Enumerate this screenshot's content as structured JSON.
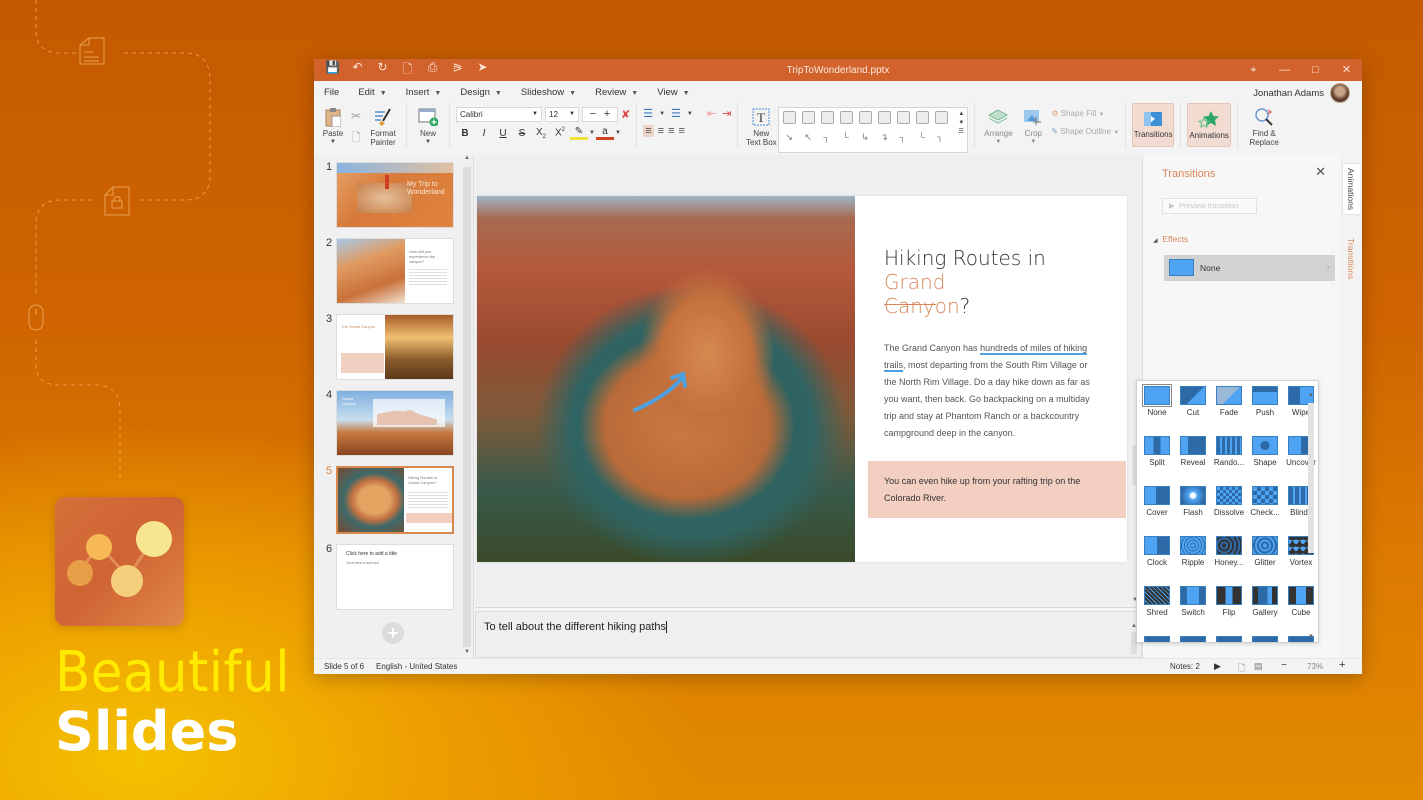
{
  "promo": {
    "line1": "Beautiful",
    "line2": "Slides"
  },
  "window": {
    "title": "TripToWonderland.pptx",
    "quick_access": [
      "save-icon",
      "undo-icon",
      "redo-icon",
      "new-doc-icon",
      "print-icon",
      "share-icon",
      "pointer-icon"
    ]
  },
  "menu": {
    "items": [
      {
        "label": "File",
        "dropdown": false
      },
      {
        "label": "Edit",
        "dropdown": true
      },
      {
        "label": "Insert",
        "dropdown": true
      },
      {
        "label": "Design",
        "dropdown": true
      },
      {
        "label": "Slideshow",
        "dropdown": true
      },
      {
        "label": "Review",
        "dropdown": true
      },
      {
        "label": "View",
        "dropdown": true
      }
    ],
    "user_name": "Jonathan Adams"
  },
  "ribbon": {
    "paste": "Paste",
    "format_painter_1": "Format",
    "format_painter_2": "Painter",
    "new": "New",
    "font_name": "Calibri",
    "font_size": "12",
    "new_text_box_1": "New",
    "new_text_box_2": "Text Box",
    "arrange": "Arrange",
    "crop": "Crop",
    "shape_fill": "Shape Fill",
    "shape_outline": "Shape Outline",
    "transitions": "Transitions",
    "animations": "Animations",
    "find_replace_1": "Find &",
    "find_replace_2": "Replace"
  },
  "thumbnails": [
    {
      "num": "1",
      "title": "My Trip to Wonderland"
    },
    {
      "num": "2",
      "title": "How will you experience the canyon?"
    },
    {
      "num": "3",
      "title": "The Grand Canyon"
    },
    {
      "num": "4",
      "title": "Grand Canyon"
    },
    {
      "num": "5",
      "title": "Hiking Routes in Grand Canyon?",
      "selected": true
    },
    {
      "num": "6",
      "title": "Click here to add a title",
      "subtitle": "Click here to add text"
    }
  ],
  "slide": {
    "title_part1": "Hiking Routes in ",
    "title_accent1": "Grand",
    "title_accent2": "Canyon",
    "title_part2": "?",
    "body_pre": "The Grand Canyon has ",
    "body_hl1": "hundreds of miles of hiking",
    "body_hl2": "trails",
    "body_post": ", most departing from the South Rim Village or the North Rim Village. Do a day hike down as far as you want, then back. Go backpacking on a multiday trip and stay at Phantom Ranch or a backcountry campground deep in the canyon.",
    "callout": "You can even hike up from your rafting trip on the Colorado River.",
    "accent_color": "#d9865a",
    "callout_bg": "#f2cfc0"
  },
  "notes": {
    "text": "To tell about the different hiking paths"
  },
  "panel": {
    "title": "Transitions",
    "preview_button": "Preview transition",
    "effects_label": "Effects",
    "selected_effect": "None",
    "side_tabs": [
      "Animations",
      "Transitions"
    ],
    "gallery": [
      {
        "label": "None",
        "selected": true
      },
      {
        "label": "Cut"
      },
      {
        "label": "Fade"
      },
      {
        "label": "Push"
      },
      {
        "label": "Wipe"
      },
      {
        "label": "Split"
      },
      {
        "label": "Reveal"
      },
      {
        "label": "Rando..."
      },
      {
        "label": "Shape"
      },
      {
        "label": "Uncover"
      },
      {
        "label": "Cover"
      },
      {
        "label": "Flash"
      },
      {
        "label": "Dissolve"
      },
      {
        "label": "Check..."
      },
      {
        "label": "Blinds"
      },
      {
        "label": "Clock"
      },
      {
        "label": "Ripple"
      },
      {
        "label": "Honey..."
      },
      {
        "label": "Glitter"
      },
      {
        "label": "Vortex"
      },
      {
        "label": "Shred"
      },
      {
        "label": "Switch"
      },
      {
        "label": "Flip"
      },
      {
        "label": "Gallery"
      },
      {
        "label": "Cube"
      }
    ]
  },
  "status": {
    "slide_info": "Slide 5 of 6",
    "language": "English - United States",
    "notes": "Notes: 2",
    "zoom": "73%"
  }
}
